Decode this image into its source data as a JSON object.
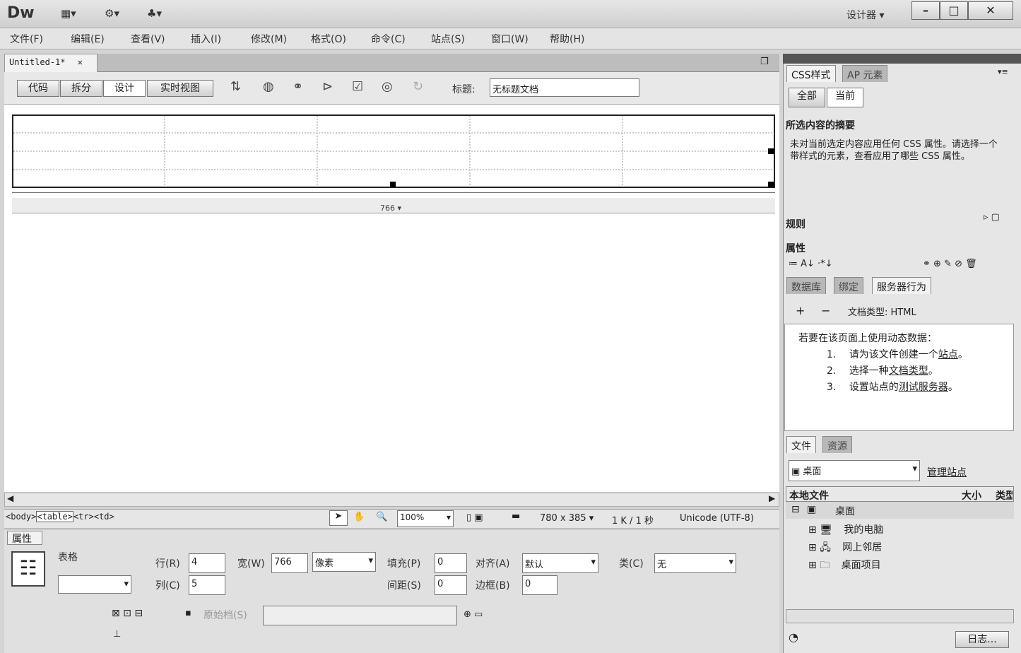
{
  "app": {
    "logo": "Dw",
    "workspace": "设计器 ▾",
    "win_min": "–",
    "win_max": "□",
    "win_close": "✕"
  },
  "menu": [
    "文件(F)",
    "编辑(E)",
    "查看(V)",
    "插入(I)",
    "修改(M)",
    "格式(O)",
    "命令(C)",
    "站点(S)",
    "窗口(W)",
    "帮助(H)"
  ],
  "doc": {
    "tab": "Untitled-1*",
    "close": "✕",
    "views": [
      "代码",
      "拆分",
      "设计",
      "实时视图"
    ],
    "title_label": "标题:",
    "title_value": "无标题文档",
    "table_width": "766 ▾"
  },
  "status": {
    "tags": [
      "<body>",
      "<table>",
      "<tr>",
      "<td>"
    ],
    "zoom": "100%",
    "size": "780 x 385 ▾",
    "transfer": "1 K / 1 秒",
    "encoding": "Unicode (UTF-8)"
  },
  "props": {
    "header": "属性",
    "type": "表格",
    "rows_label": "行(R)",
    "rows": "4",
    "cols_label": "列(C)",
    "cols": "5",
    "width_label": "宽(W)",
    "width": "766",
    "width_unit": "像素",
    "pad_label": "填充(P)",
    "pad": "0",
    "space_label": "间距(S)",
    "space": "0",
    "align_label": "对齐(A)",
    "align": "默认",
    "border_label": "边框(B)",
    "border": "0",
    "class_label": "类(C)",
    "class": "无",
    "src_label": "原始档(S)"
  },
  "css_panel": {
    "tabs": [
      "CSS样式",
      "AP 元素"
    ],
    "modes": [
      "全部",
      "当前"
    ],
    "summary_title": "所选内容的摘要",
    "summary_text": "未对当前选定内容应用任何 CSS 属性。请选择一个带样式的元素，查看应用了哪些 CSS 属性。",
    "rules": "规则",
    "properties": "属性"
  },
  "server_panel": {
    "tabs": [
      "数据库",
      "绑定",
      "服务器行为"
    ],
    "plus": "+",
    "minus": "−",
    "doctype": "文档类型: HTML",
    "intro": "若要在该页面上使用动态数据：",
    "steps": [
      {
        "num": "1.",
        "text": "请为该文件创建一个",
        "link": "站点",
        "end": "。"
      },
      {
        "num": "2.",
        "text": "选择一种",
        "link": "文档类型",
        "end": "。"
      },
      {
        "num": "3.",
        "text": "设置站点的",
        "link": "测试服务器",
        "end": "。"
      }
    ]
  },
  "files_panel": {
    "tabs": [
      "文件",
      "资源"
    ],
    "location": "桌面",
    "manage": "管理站点",
    "col_local": "本地文件",
    "col_size": "大小",
    "col_type": "类型",
    "root": "桌面",
    "items": [
      "我的电脑",
      "网上邻居",
      "桌面项目"
    ],
    "log": "日志..."
  }
}
